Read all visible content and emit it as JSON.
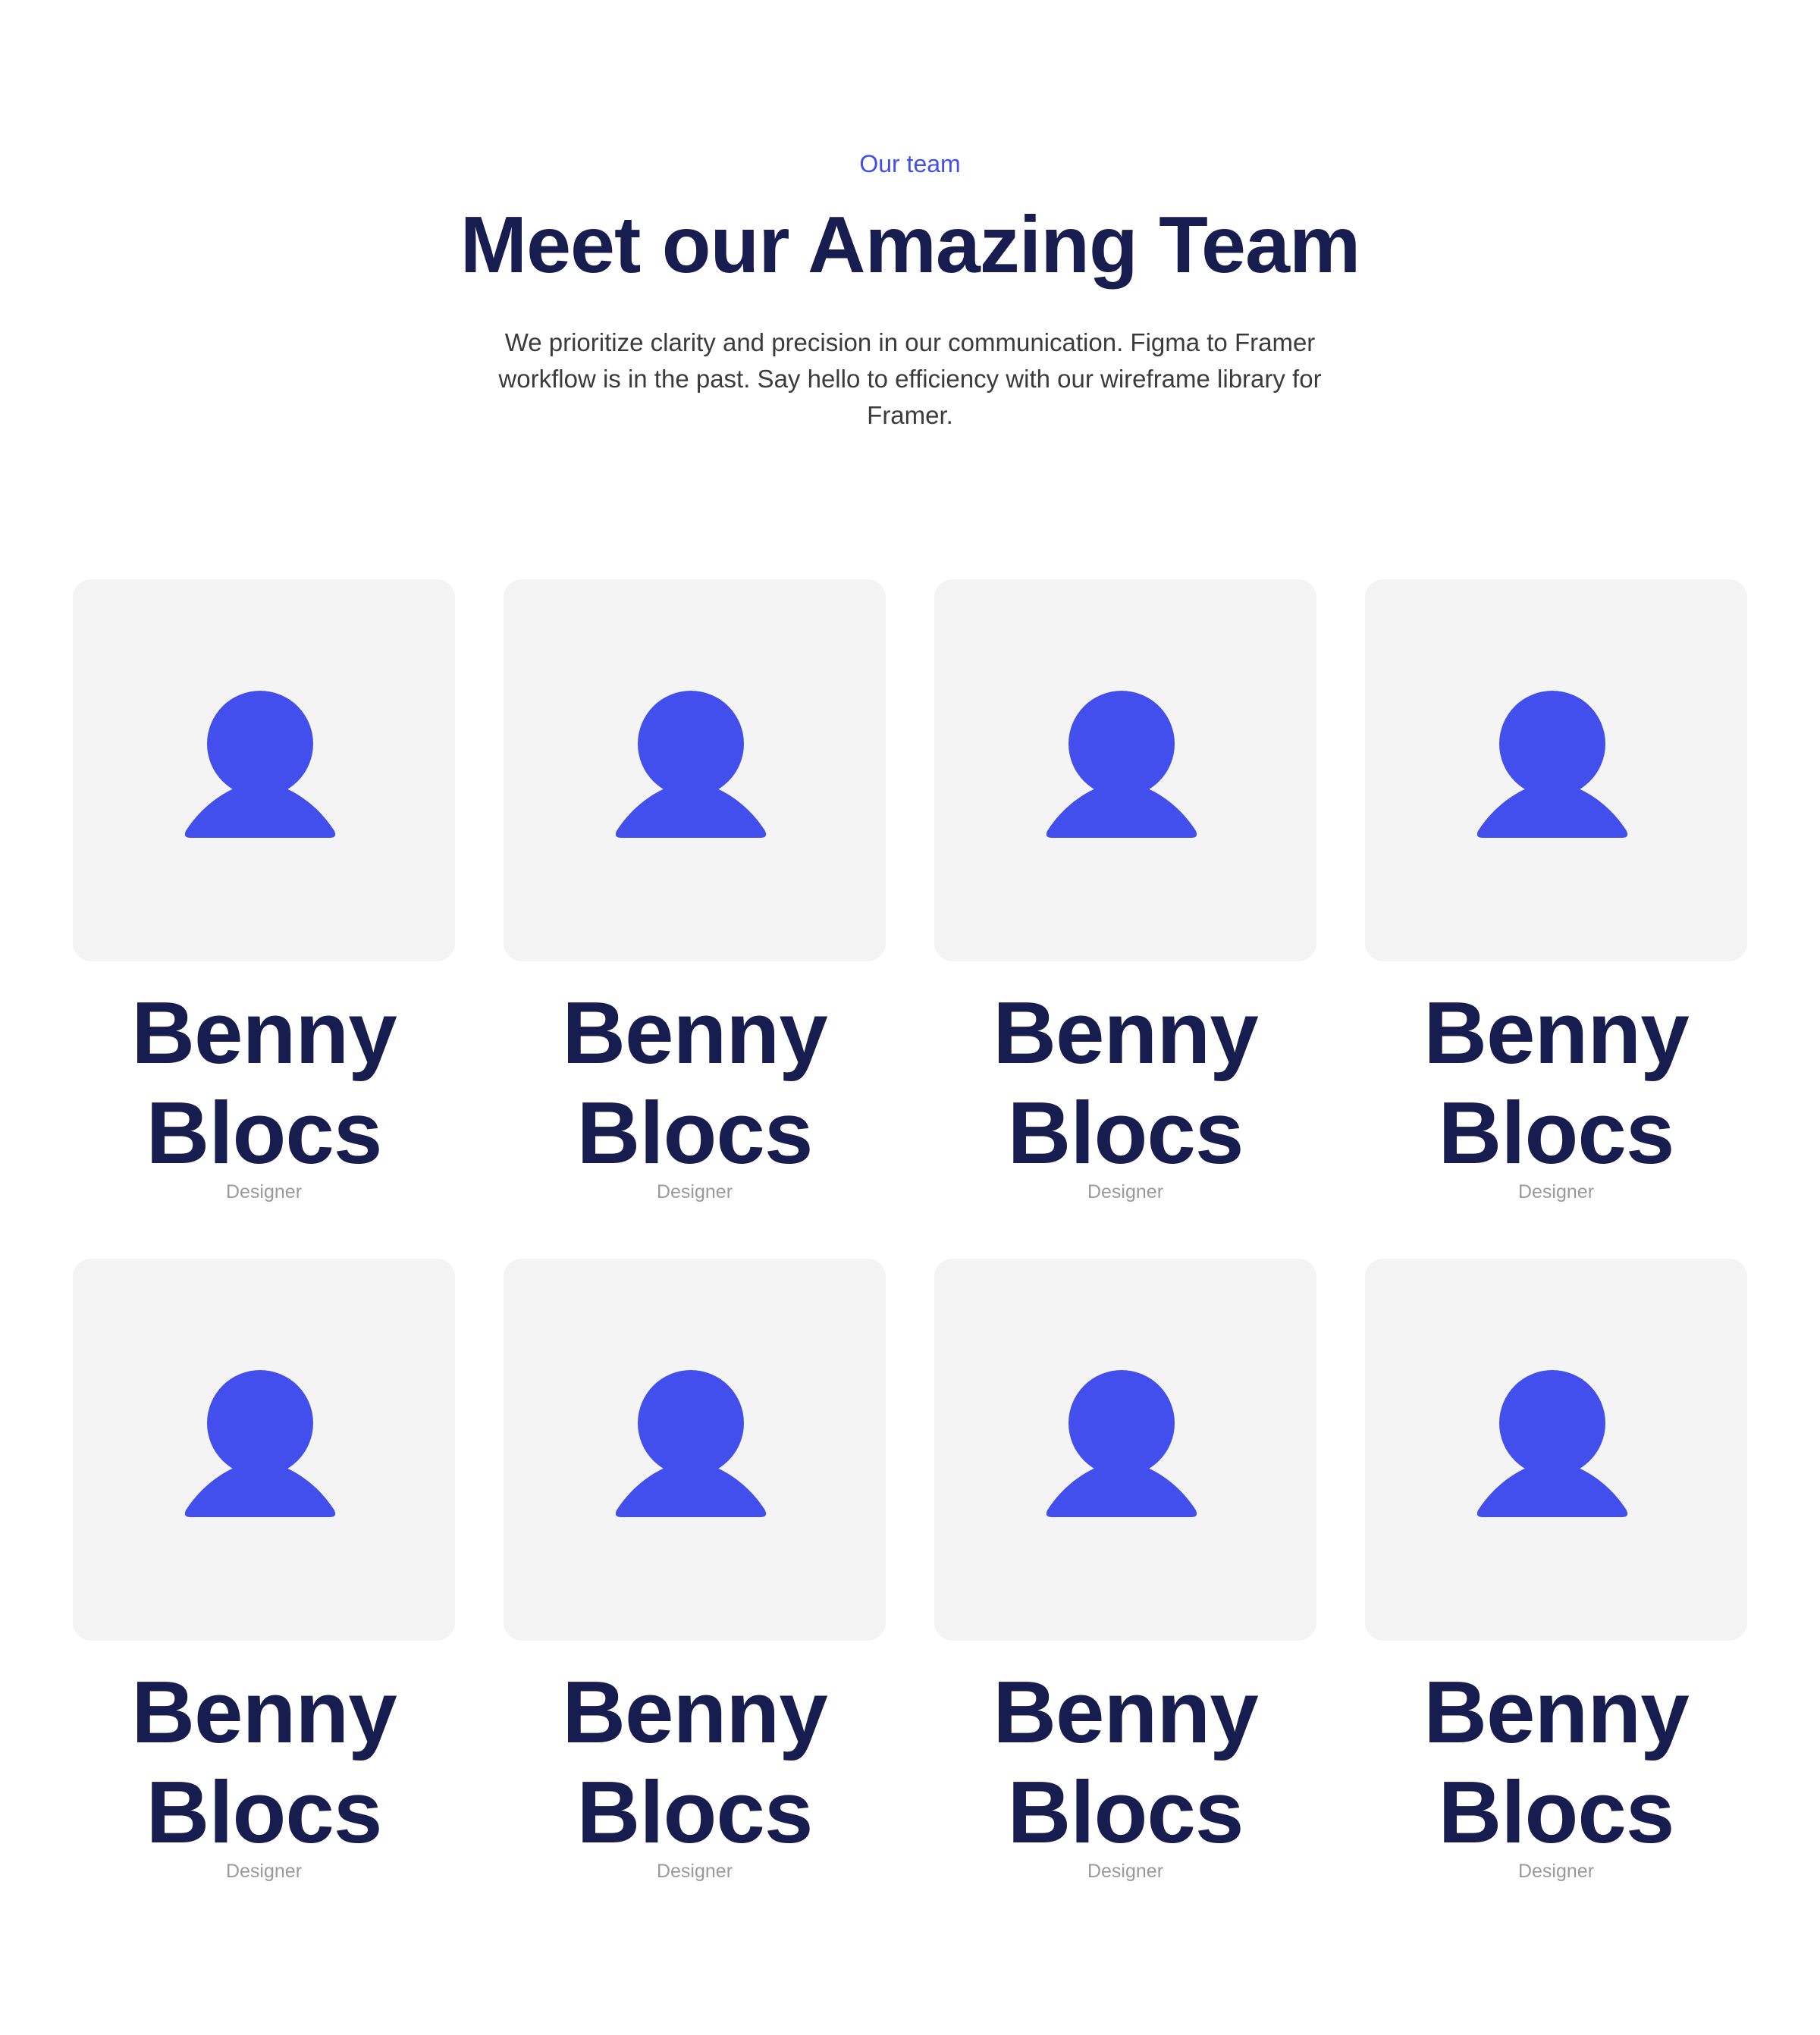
{
  "header": {
    "eyebrow": "Our team",
    "title": "Meet our Amazing Team",
    "subtitle": "We prioritize clarity and precision in our communication. Figma to Framer workflow is in the past. Say hello to efficiency with our wireframe library for Framer."
  },
  "colors": {
    "accent": "#424fec",
    "heading": "#181d4f",
    "body_text": "#3b3b3b",
    "muted": "#9a9a9a",
    "card_bg": "#f4f4f5"
  },
  "members": [
    {
      "first": "Benny",
      "last": "Blocs",
      "role": "Designer",
      "icon": "user-icon"
    },
    {
      "first": "Benny",
      "last": "Blocs",
      "role": "Designer",
      "icon": "user-icon"
    },
    {
      "first": "Benny",
      "last": "Blocs",
      "role": "Designer",
      "icon": "user-icon"
    },
    {
      "first": "Benny",
      "last": "Blocs",
      "role": "Designer",
      "icon": "user-icon"
    },
    {
      "first": "Benny",
      "last": "Blocs",
      "role": "Designer",
      "icon": "user-icon"
    },
    {
      "first": "Benny",
      "last": "Blocs",
      "role": "Designer",
      "icon": "user-icon"
    },
    {
      "first": "Benny",
      "last": "Blocs",
      "role": "Designer",
      "icon": "user-icon"
    },
    {
      "first": "Benny",
      "last": "Blocs",
      "role": "Designer",
      "icon": "user-icon"
    }
  ]
}
